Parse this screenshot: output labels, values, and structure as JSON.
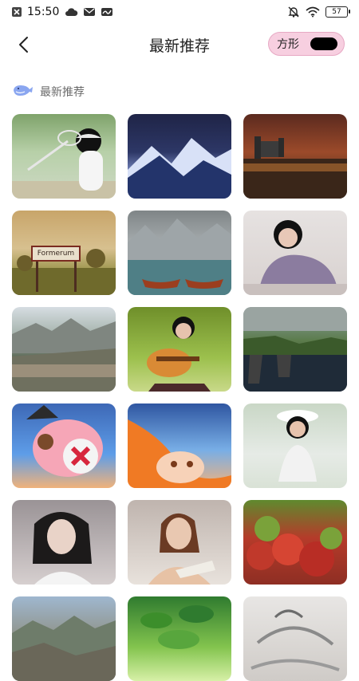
{
  "status_bar": {
    "time": "15:50",
    "battery": "57",
    "left_icons": [
      "close-box-icon",
      "cloud-icon",
      "mail-icon",
      "app-icon"
    ],
    "right_icons": [
      "mute-bell-icon",
      "wifi-icon",
      "battery-icon"
    ]
  },
  "header": {
    "title": "最新推荐",
    "back_icon": "back-arrow-icon",
    "toggle_label": "方形",
    "toggle_color": "#f7cfe0",
    "knob_color": "#000000"
  },
  "section": {
    "title": "最新推荐",
    "icon": "whale-icon",
    "icon_color": "#8aa6f0"
  },
  "grid": {
    "columns": 3,
    "items": [
      {
        "name": "wallpaper-tennis-girl"
      },
      {
        "name": "wallpaper-night-mountains"
      },
      {
        "name": "wallpaper-castle-lake"
      },
      {
        "name": "wallpaper-formerum-sign",
        "sign_text": "Formerum"
      },
      {
        "name": "wallpaper-boats-lake"
      },
      {
        "name": "wallpaper-girl-sitting"
      },
      {
        "name": "wallpaper-mountain-river"
      },
      {
        "name": "wallpaper-girl-guitar"
      },
      {
        "name": "wallpaper-coast-cliffs"
      },
      {
        "name": "wallpaper-cartoon-chopper"
      },
      {
        "name": "wallpaper-cartoon-nami"
      },
      {
        "name": "wallpaper-girl-white-hat"
      },
      {
        "name": "wallpaper-girl-portrait"
      },
      {
        "name": "wallpaper-girl-book"
      },
      {
        "name": "wallpaper-red-flowers"
      },
      {
        "name": "wallpaper-hills-landscape"
      },
      {
        "name": "wallpaper-green-leaves"
      },
      {
        "name": "wallpaper-ink-painting"
      }
    ]
  }
}
